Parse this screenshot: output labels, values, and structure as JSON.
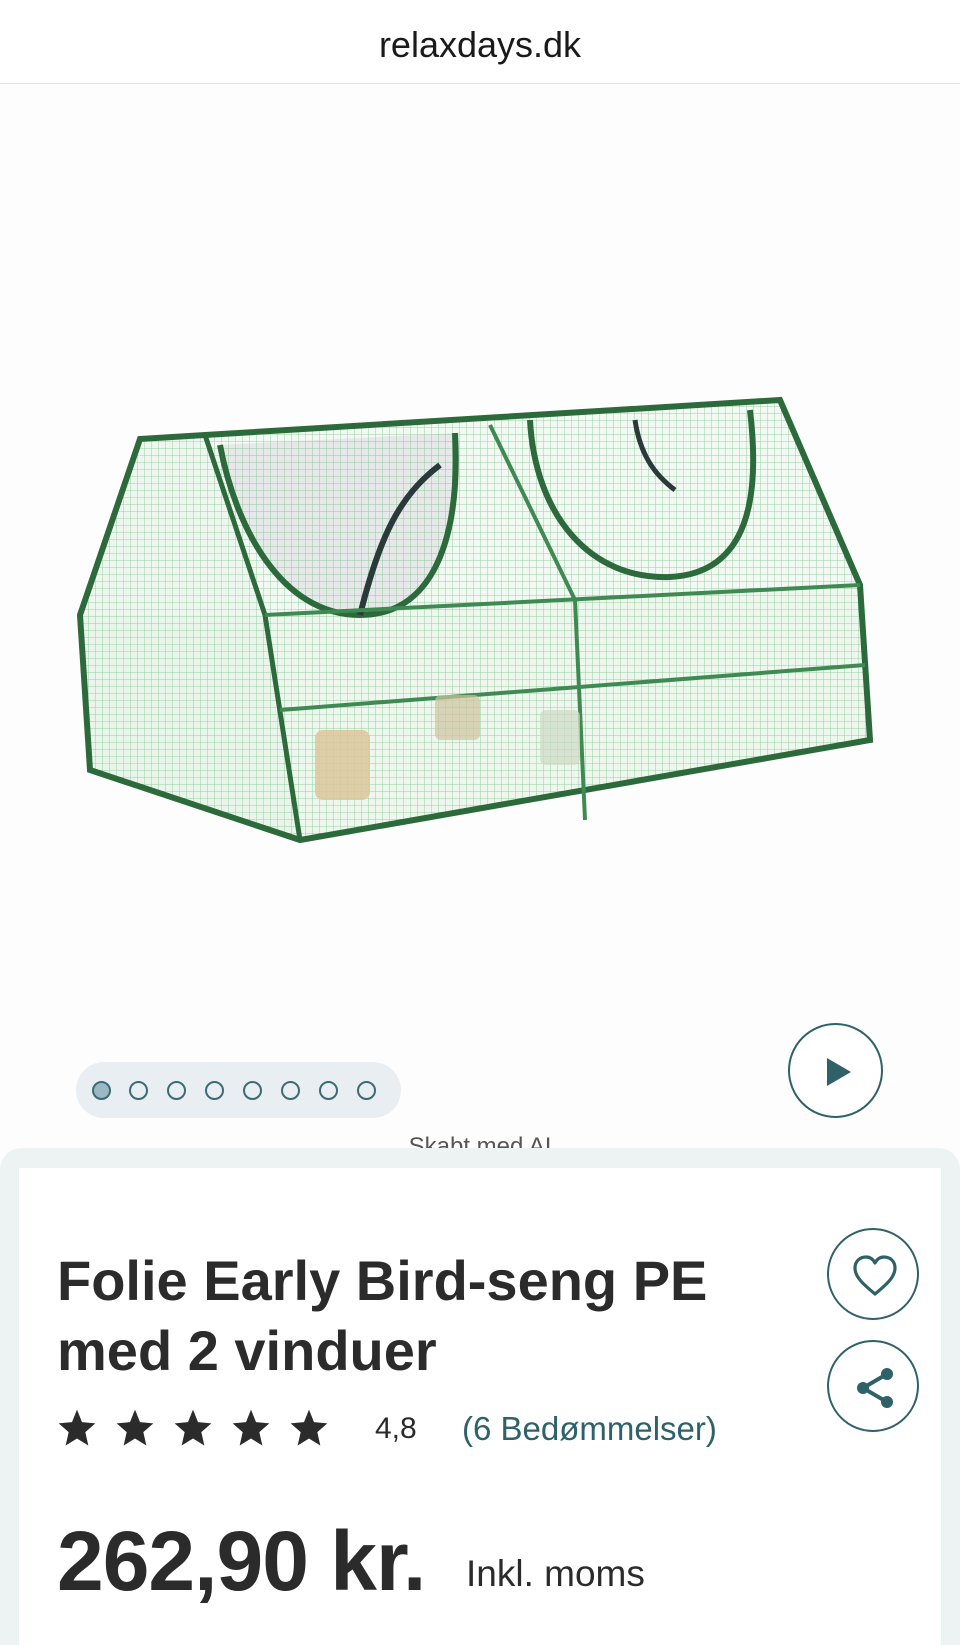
{
  "browser": {
    "domain": "relaxdays.dk"
  },
  "gallery": {
    "image_alt": "Folie Early Bird-seng PE med 2 vinduer",
    "slide_count": 8,
    "active_slide": 1,
    "ai_note": "Skabt med AI",
    "play_icon": "play-icon"
  },
  "product": {
    "title": "Folie Early Bird-seng PE med 2 vinduer",
    "rating_value": "4,8",
    "rating_stars": 5,
    "reviews_label": "(6 Bedømmelser)",
    "price": "262,90 kr.",
    "vat_note": "Inkl. moms"
  },
  "actions": {
    "favorite_icon": "heart-icon",
    "share_icon": "share-icon"
  },
  "colors": {
    "accent": "#2e6168",
    "dots_bg": "#e8eef2",
    "section_bg": "#edf2f2",
    "text": "#2b2b2b"
  }
}
